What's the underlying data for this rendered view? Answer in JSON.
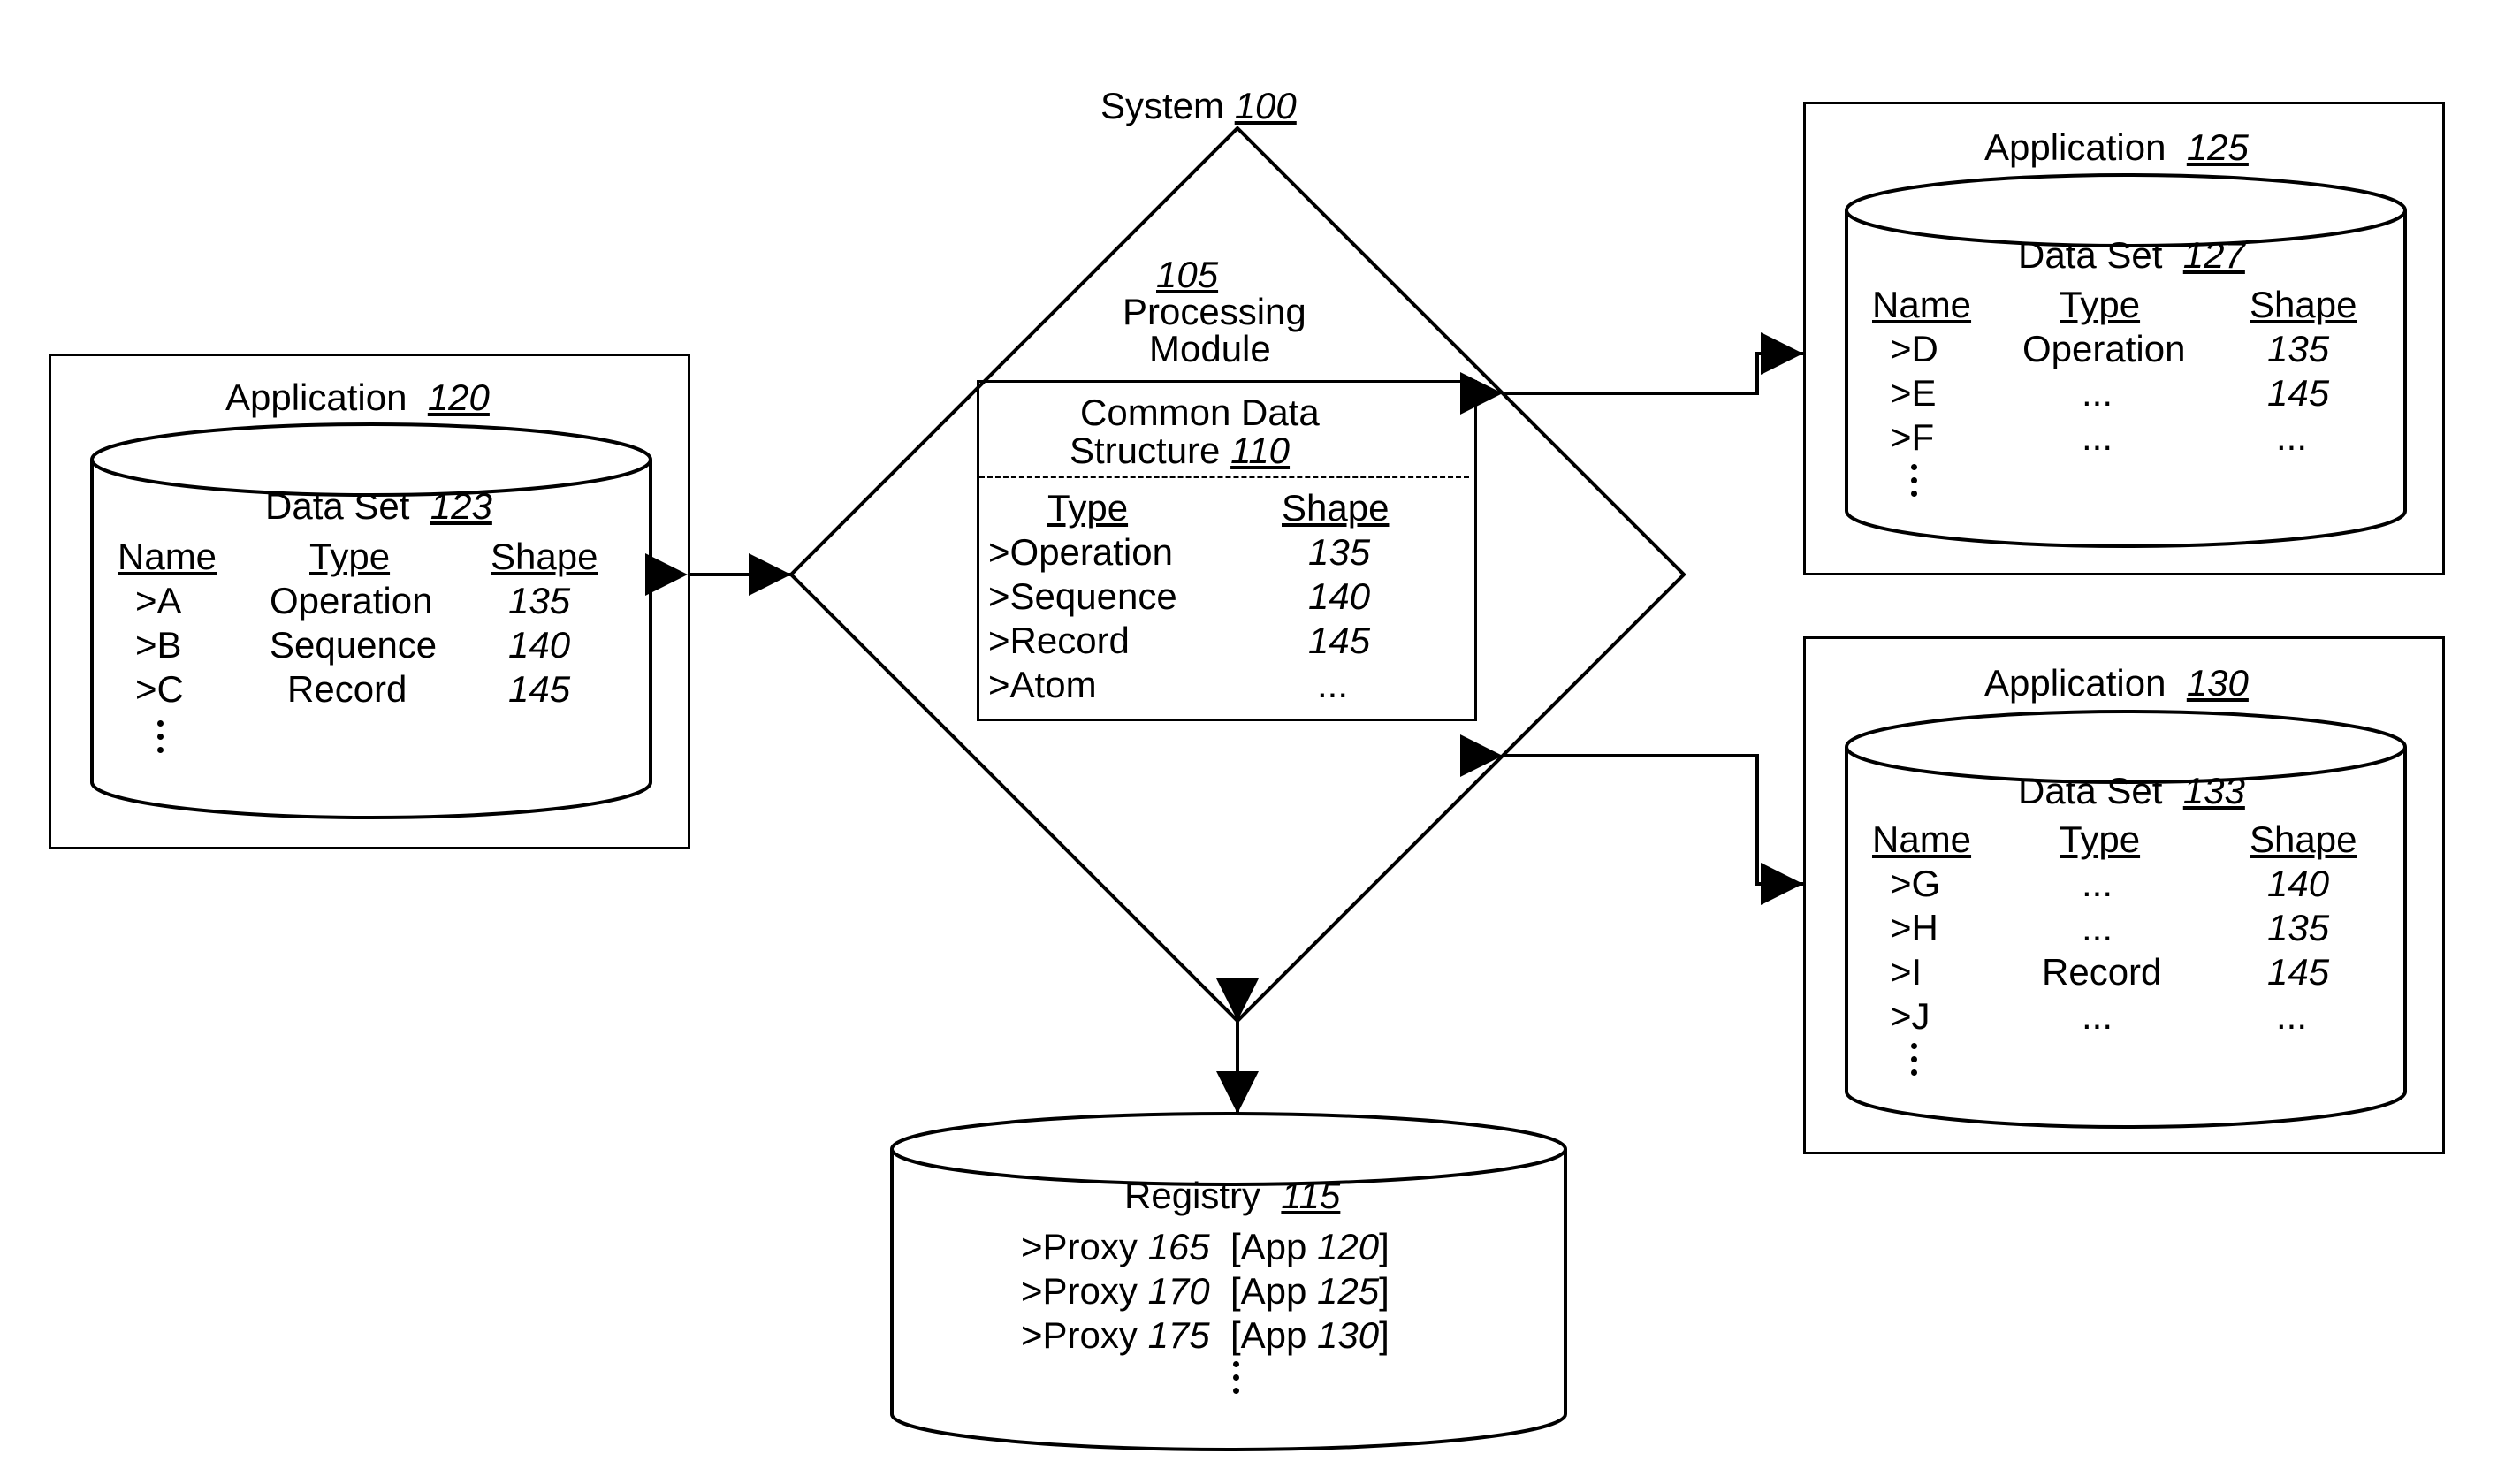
{
  "system": {
    "title": "System",
    "ref": "100"
  },
  "processing": {
    "ref": "105",
    "label": "Processing\nModule"
  },
  "cds": {
    "title": "Common Data\nStructure",
    "ref": "110",
    "h_type": "Type",
    "h_shape": "Shape",
    "rows": [
      {
        "type": ">Operation",
        "shape": "135"
      },
      {
        "type": ">Sequence",
        "shape": "140"
      },
      {
        "type": ">Record",
        "shape": "145"
      },
      {
        "type": ">Atom",
        "shape": "..."
      }
    ]
  },
  "app120": {
    "title": "Application",
    "ref": "120",
    "ds_title": "Data Set",
    "ds_ref": "123",
    "h_name": "Name",
    "h_type": "Type",
    "h_shape": "Shape",
    "rows": [
      {
        "name": ">A",
        "type": "Operation",
        "shape": "135"
      },
      {
        "name": ">B",
        "type": "Sequence",
        "shape": "140"
      },
      {
        "name": ">C",
        "type": "Record",
        "shape": "145"
      }
    ]
  },
  "app125": {
    "title": "Application",
    "ref": "125",
    "ds_title": "Data Set",
    "ds_ref": "127",
    "h_name": "Name",
    "h_type": "Type",
    "h_shape": "Shape",
    "rows": [
      {
        "name": ">D",
        "type": "Operation",
        "shape": "135"
      },
      {
        "name": ">E",
        "type": "...",
        "shape": "145"
      },
      {
        "name": ">F",
        "type": "...",
        "shape": "..."
      }
    ]
  },
  "app130": {
    "title": "Application",
    "ref": "130",
    "ds_title": "Data Set",
    "ds_ref": "133",
    "h_name": "Name",
    "h_type": "Type",
    "h_shape": "Shape",
    "rows": [
      {
        "name": ">G",
        "type": "...",
        "shape": "140"
      },
      {
        "name": ">H",
        "type": "...",
        "shape": "135"
      },
      {
        "name": ">I",
        "type": "Record",
        "shape": "145"
      },
      {
        "name": ">J",
        "type": "...",
        "shape": "..."
      }
    ]
  },
  "registry": {
    "title": "Registry",
    "ref": "115",
    "rows": [
      ">Proxy 165  [App 120]",
      ">Proxy 170  [App 125]",
      ">Proxy 175  [App 130]"
    ]
  }
}
